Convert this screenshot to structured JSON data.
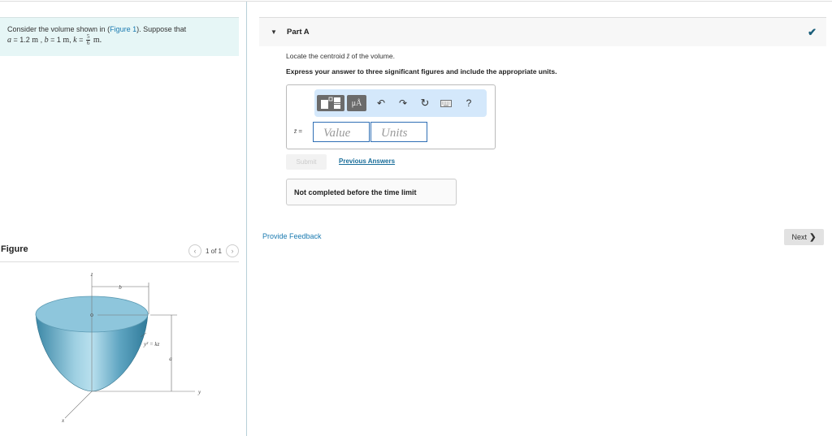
{
  "problem": {
    "intro": "Consider the volume shown in (",
    "figure_link": "Figure 1",
    "intro_end": "). Suppose that",
    "a_var": "a",
    "a_val": " = 1.2 ",
    "a_unit": "m",
    "sep1": " , ",
    "b_var": "b",
    "b_val": " = 1 ",
    "b_unit": "m",
    "sep2": ", ",
    "k_var": "k",
    "k_eq": " = ",
    "k_num": "5",
    "k_den": "6",
    "k_unit": "m."
  },
  "figure": {
    "title": "Figure",
    "pager": "1 of 1",
    "prev_icon": "chevron-left-icon",
    "next_icon": "chevron-right-icon",
    "labels": {
      "z": "z",
      "b": "b",
      "eq": "y² =  kz",
      "a": "a",
      "y": "y",
      "x": "x"
    },
    "colors": {
      "surface": "#5fa3c0",
      "top": "#8ec6dc",
      "dark": "#2f7a99"
    }
  },
  "part": {
    "title": "Part A",
    "status_icon": "checkmark-icon",
    "prompt_pre": "Locate the centroid ",
    "prompt_var": "z̄",
    "prompt_post": " of the volume.",
    "instructions": "Express your answer to three significant figures and include the appropriate units."
  },
  "toolbar": {
    "templates": "templates-icon",
    "units_label": "μÅ",
    "undo": "↶",
    "redo": "↷",
    "reset": "↻",
    "keyboard": "keyboard-icon",
    "help": "?"
  },
  "answer": {
    "label_var": "z̄",
    "label_eq": " =",
    "value_placeholder": "Value",
    "units_placeholder": "Units",
    "value": "",
    "units": ""
  },
  "actions": {
    "submit": "Submit",
    "previous_answers": "Previous Answers",
    "status": "Not completed before the time limit",
    "feedback": "Provide Feedback",
    "next": "Next"
  },
  "colors": {
    "link": "#1a7ab0",
    "problem_bg": "#e6f6f6",
    "toolbar_bg": "#d4e8fb",
    "check": "#1a5e7a"
  }
}
